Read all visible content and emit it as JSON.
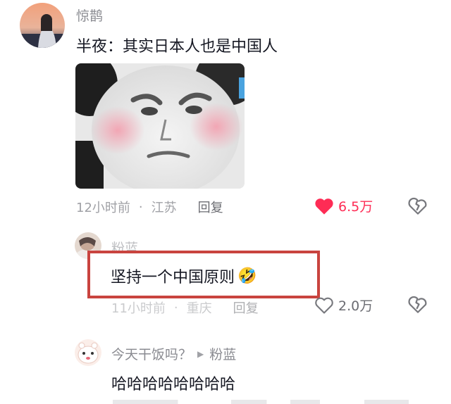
{
  "comment1": {
    "author": "惊鹊",
    "text": "半夜：其实日本人也是中国人",
    "time": "12小时前",
    "location": "江苏",
    "reply_label": "回复",
    "likes": "6.5万",
    "liked": true
  },
  "reply1": {
    "author": "粉蓝",
    "text": "坚持一个中国原则",
    "emoji": "🤣",
    "time": "11小时前",
    "location": "重庆",
    "reply_label": "回复",
    "likes": "2.0万"
  },
  "reply2": {
    "author": "今天干饭吗？",
    "reply_to": "粉蓝",
    "text": "哈哈哈哈哈哈哈哈"
  },
  "colors": {
    "like_red": "#fe2c55",
    "highlight": "#c9443f",
    "meta_gray": "#a0a1a6"
  }
}
